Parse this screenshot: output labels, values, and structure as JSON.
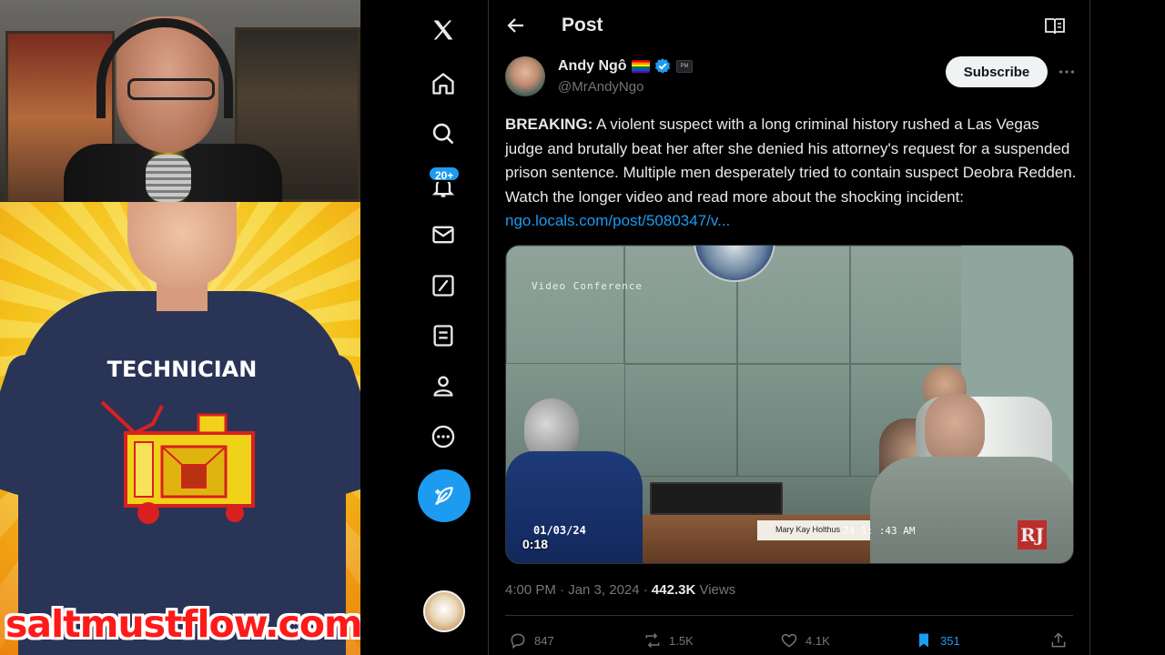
{
  "overlay": {
    "shirt_text": "TECHNICIAN",
    "site_url": "saltmustflow.com"
  },
  "nav": {
    "items": [
      "x-logo",
      "home",
      "explore",
      "notifications",
      "messages",
      "grok",
      "lists",
      "profile",
      "more"
    ],
    "notifications_badge": "20+"
  },
  "header": {
    "title": "Post"
  },
  "author": {
    "name": "Andy Ngô",
    "handle": "@MrAndyNgo",
    "verified": true,
    "affiliate_badge": "PM",
    "subscribe_label": "Subscribe"
  },
  "tweet": {
    "lead": "BREAKING:",
    "body": " A violent suspect with a long criminal history rushed a Las Vegas judge and brutally beat her after she denied his attorney's request for a suspended prison sentence. Multiple men desperately tried to contain suspect Deobra Redden. Watch the longer video and read more about the shocking incident: ",
    "link": "ngo.locals.com/post/5080347/v..."
  },
  "video": {
    "overlay_label": "Video Conference",
    "date": "01/03/24",
    "clock": "24 1:  :43 AM",
    "nameplate": "Mary Kay Holthus",
    "duration": "0:18",
    "watermark": "RJ"
  },
  "meta": {
    "time": "4:00 PM · Jan 3, 2024 · ",
    "views_count": "442.3K",
    "views_label": " Views"
  },
  "actions": {
    "replies": "847",
    "reposts": "1.5K",
    "likes": "4.1K",
    "bookmarks": "351"
  },
  "colors": {
    "accent": "#1d9bf0",
    "background": "#000000",
    "text": "#e7e9ea",
    "muted": "#71767b",
    "site_url": "#ff1a1a"
  }
}
